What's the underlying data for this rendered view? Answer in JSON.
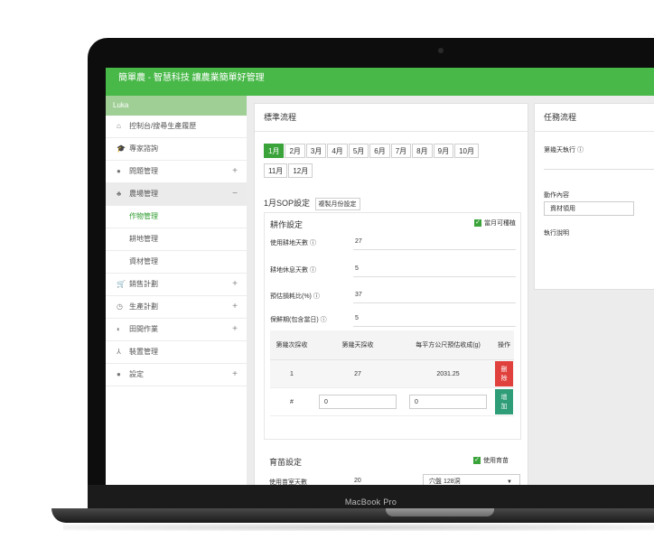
{
  "device": {
    "label": "MacBook Pro"
  },
  "app": {
    "title": "簡單農 - 智慧科技 讓農業簡單好管理"
  },
  "sidebar": {
    "user": "Luka",
    "items": [
      {
        "icon": "home-icon",
        "glyph": "⌂",
        "label": "控制台/搜尋生產履歷",
        "toggle": ""
      },
      {
        "icon": "graduation-cap-icon",
        "glyph": "🎓",
        "label": "專家諮詢",
        "toggle": ""
      },
      {
        "icon": "question-circle-icon",
        "glyph": "●",
        "label": "問題管理",
        "toggle": "+"
      },
      {
        "icon": "sprout-icon",
        "glyph": "♣",
        "label": "農場管理",
        "toggle": "−"
      }
    ],
    "subitems": [
      {
        "label": "作物管理"
      },
      {
        "label": "耕地管理"
      },
      {
        "label": "資材管理"
      }
    ],
    "items2": [
      {
        "icon": "cart-icon",
        "glyph": "🛒",
        "label": "銷售計劃",
        "toggle": "+"
      },
      {
        "icon": "clock-icon",
        "glyph": "◷",
        "label": "生產計劃",
        "toggle": "+"
      },
      {
        "icon": "field-icon",
        "glyph": "◐",
        "label": "田間作業",
        "toggle": "+"
      },
      {
        "icon": "sitemap-icon",
        "glyph": "⅄",
        "label": "裝置管理",
        "toggle": ""
      },
      {
        "icon": "user-circle-icon",
        "glyph": "●",
        "label": "設定",
        "toggle": "+"
      }
    ]
  },
  "standard": {
    "title": "標準流程",
    "months": [
      "1月",
      "2月",
      "3月",
      "4月",
      "5月",
      "6月",
      "7月",
      "8月",
      "9月",
      "10月",
      "11月",
      "12月"
    ],
    "selected_month": "1月",
    "sop_title": "1月SOP設定",
    "copy_label": "複製月份設定",
    "farming": {
      "title": "耕作設定",
      "can_plant": "當月可種植",
      "fields": [
        {
          "label": "使用耕地天數 ⓘ",
          "value": "27"
        },
        {
          "label": "耕地休息天數 ⓘ",
          "value": "5"
        },
        {
          "label": "預估損耗比(%) ⓘ",
          "value": "37"
        },
        {
          "label": "保鮮期(包含當日) ⓘ",
          "value": "5"
        }
      ],
      "table": {
        "headers": [
          "第幾次採收",
          "第幾天採收",
          "每平方公尺預估收成(g)",
          "操作"
        ],
        "row": {
          "n": "1",
          "day": "27",
          "yield": "2031.25",
          "action": "刪除"
        },
        "new_row": {
          "n": "#",
          "day": "0",
          "yield": "0",
          "action": "增加"
        }
      }
    },
    "seedling": {
      "title": "育苗設定",
      "use_seedling": "使用育苗",
      "days_label": "使用苗室天數",
      "days_value": "20",
      "tray": "穴盤 128洞"
    }
  },
  "task": {
    "title": "任務流程",
    "day_label": "第幾天執行 ⓘ",
    "action_label": "動作內容",
    "action_value": "資材領用",
    "desc_label": "執行說明"
  }
}
